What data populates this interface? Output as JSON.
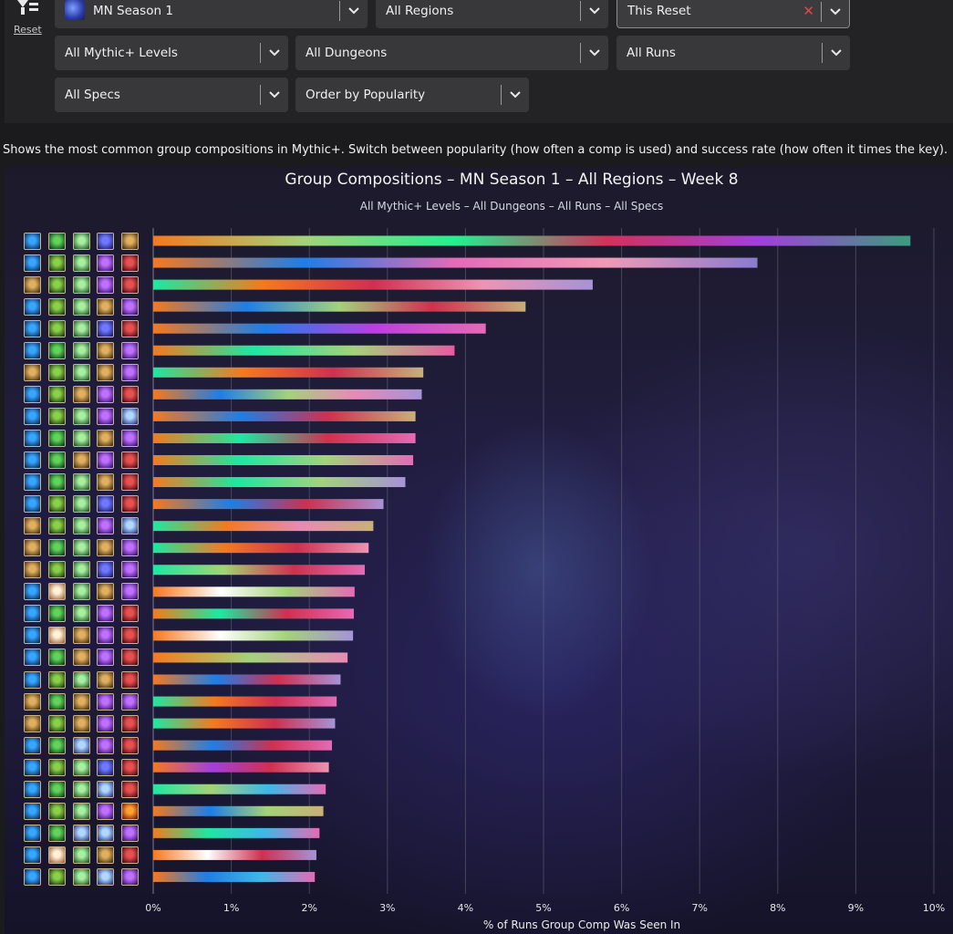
{
  "filters": {
    "reset_label": "Reset",
    "season": "MN Season 1",
    "region": "All Regions",
    "period": "This Reset",
    "level": "All Mythic+ Levels",
    "dungeon": "All Dungeons",
    "runs": "All Runs",
    "specs": "All Specs",
    "order": "Order by Popularity"
  },
  "description": "Shows the most common group compositions in Mythic+. Switch between popularity (how often a comp is used) and success rate (how often it times the key).",
  "colors": {
    "select_bg": "#38383a",
    "clear": "#e04848",
    "icon_border": "#c9b48a",
    "grid": "#6a6a7a"
  },
  "chart_data": {
    "type": "bar",
    "orientation": "horizontal",
    "title": "Group Compositions – MN Season 1 – All Regions – Week 8",
    "subtitle": "All Mythic+ Levels – All Dungeons – All Runs – All Specs",
    "xlabel": "% of Runs Group Comp Was Seen In",
    "xlim": [
      0,
      10
    ],
    "xticks": [
      "0%",
      "1%",
      "2%",
      "3%",
      "4%",
      "5%",
      "6%",
      "7%",
      "8%",
      "9%",
      "10%"
    ],
    "grid": true,
    "values": [
      9.7,
      7.74,
      5.63,
      4.77,
      4.26,
      3.86,
      3.46,
      3.44,
      3.36,
      3.36,
      3.33,
      3.23,
      2.95,
      2.82,
      2.76,
      2.71,
      2.58,
      2.57,
      2.56,
      2.49,
      2.4,
      2.35,
      2.33,
      2.29,
      2.25,
      2.21,
      2.18,
      2.13,
      2.09,
      2.07
    ],
    "bar_colors": [
      [
        "#f5791e",
        "#a4d27a",
        "#23f08f",
        "#d3315a",
        "#a23fdc",
        "#3d9c7e"
      ],
      [
        "#f5791e",
        "#1e7ee6",
        "#e56bb8",
        "#f09ab6",
        "#8a7bd0"
      ],
      [
        "#1de8a2",
        "#f5791e",
        "#cf3050",
        "#ef93b4",
        "#a693d6"
      ],
      [
        "#f5791e",
        "#1e7ee6",
        "#a4d27a",
        "#cf3050",
        "#c8b07a"
      ],
      [
        "#f5791e",
        "#1e7ee6",
        "#bb3fe0",
        "#e46bb5"
      ],
      [
        "#f5791e",
        "#1de8a2",
        "#a4d27a",
        "#e85ba0"
      ],
      [
        "#1de8a2",
        "#f5791e",
        "#cf3050",
        "#c8b07a"
      ],
      [
        "#f5791e",
        "#1e7ee6",
        "#a4d27a",
        "#e88ab6",
        "#a693d6"
      ],
      [
        "#f5791e",
        "#1e7ee6",
        "#cf3050",
        "#c8b07a"
      ],
      [
        "#f5791e",
        "#1de8a2",
        "#cf3050",
        "#e46bb5"
      ],
      [
        "#f5791e",
        "#1de8a2",
        "#a4d27a",
        "#e46bb5"
      ],
      [
        "#f5791e",
        "#1de8a2",
        "#a4d27a",
        "#a693d6"
      ],
      [
        "#f5791e",
        "#1e7ee6",
        "#cf3050",
        "#a693d6"
      ],
      [
        "#1de8a2",
        "#f5791e",
        "#e88ab6",
        "#c8b07a"
      ],
      [
        "#1de8a2",
        "#f5791e",
        "#cf3050",
        "#ef93b4"
      ],
      [
        "#1de8a2",
        "#a4d27a",
        "#cf3050",
        "#e46bb5"
      ],
      [
        "#f5791e",
        "#ffffff",
        "#a4d27a",
        "#e46bb5"
      ],
      [
        "#f5791e",
        "#1de8a2",
        "#cf3050",
        "#e46bb5"
      ],
      [
        "#f5791e",
        "#ffffff",
        "#a4d27a",
        "#a693d6"
      ],
      [
        "#f5791e",
        "#a4d27a",
        "#e88ab6"
      ],
      [
        "#f5791e",
        "#1e7ee6",
        "#cf3050",
        "#a693d6"
      ],
      [
        "#1de8a2",
        "#f5791e",
        "#cf3050",
        "#e46bb5"
      ],
      [
        "#1de8a2",
        "#f5791e",
        "#cf3050",
        "#a693d6"
      ],
      [
        "#f5791e",
        "#1e7ee6",
        "#cf3050",
        "#e46bb5"
      ],
      [
        "#f5791e",
        "#a23fdc",
        "#cf3050",
        "#ef93b4"
      ],
      [
        "#1de8a2",
        "#a4d27a",
        "#3db8e8",
        "#e46bb5"
      ],
      [
        "#f5791e",
        "#1e7ee6",
        "#a4d27a",
        "#c8b07a"
      ],
      [
        "#f5791e",
        "#1de8a2",
        "#3db8e8",
        "#e46bb5"
      ],
      [
        "#f5791e",
        "#ffffff",
        "#cf3050",
        "#a693d6"
      ],
      [
        "#f5791e",
        "#1e7ee6",
        "#3db8e8",
        "#e46bb5"
      ]
    ],
    "spec_icon_palette": {
      "blue-tank": [
        "#37a6ff",
        "#0d2a55"
      ],
      "green-heal": [
        "#5fd35a",
        "#0f3d1a"
      ],
      "green-dps": [
        "#8ad048",
        "#1d3a10"
      ],
      "fel-green": [
        "#a8f0a0",
        "#235a2a"
      ],
      "purple-dps": [
        "#c070ff",
        "#3a1370"
      ],
      "blue-purple": [
        "#6f78ff",
        "#1a1f6a"
      ],
      "red-dps": [
        "#e85050",
        "#4a0c18"
      ],
      "gold-dps": [
        "#e0b060",
        "#4a3210"
      ],
      "white-heal": [
        "#fff0d8",
        "#a06a40"
      ],
      "ice-dps": [
        "#b0d8ff",
        "#2a3a80"
      ],
      "fire-dps": [
        "#ffa030",
        "#7a1a08"
      ]
    },
    "spec_icons": [
      [
        "blue-tank",
        "green-heal",
        "fel-green",
        "blue-purple",
        "gold-dps"
      ],
      [
        "blue-tank",
        "green-dps",
        "fel-green",
        "purple-dps",
        "red-dps"
      ],
      [
        "gold-dps",
        "green-dps",
        "fel-green",
        "purple-dps",
        "red-dps"
      ],
      [
        "blue-tank",
        "green-dps",
        "fel-green",
        "gold-dps",
        "purple-dps"
      ],
      [
        "blue-tank",
        "green-dps",
        "fel-green",
        "blue-purple",
        "red-dps"
      ],
      [
        "blue-tank",
        "green-heal",
        "fel-green",
        "gold-dps",
        "purple-dps"
      ],
      [
        "gold-dps",
        "green-dps",
        "fel-green",
        "gold-dps",
        "purple-dps"
      ],
      [
        "blue-tank",
        "green-dps",
        "gold-dps",
        "purple-dps",
        "red-dps"
      ],
      [
        "blue-tank",
        "green-dps",
        "fel-green",
        "purple-dps",
        "ice-dps"
      ],
      [
        "blue-tank",
        "green-heal",
        "fel-green",
        "gold-dps",
        "purple-dps"
      ],
      [
        "blue-tank",
        "green-heal",
        "gold-dps",
        "purple-dps",
        "red-dps"
      ],
      [
        "blue-tank",
        "green-heal",
        "fel-green",
        "gold-dps",
        "red-dps"
      ],
      [
        "blue-tank",
        "green-dps",
        "fel-green",
        "blue-purple",
        "red-dps"
      ],
      [
        "gold-dps",
        "green-dps",
        "fel-green",
        "purple-dps",
        "ice-dps"
      ],
      [
        "gold-dps",
        "green-heal",
        "fel-green",
        "gold-dps",
        "purple-dps"
      ],
      [
        "gold-dps",
        "green-dps",
        "fel-green",
        "blue-purple",
        "purple-dps"
      ],
      [
        "blue-tank",
        "white-heal",
        "fel-green",
        "gold-dps",
        "purple-dps"
      ],
      [
        "blue-tank",
        "green-heal",
        "fel-green",
        "purple-dps",
        "red-dps"
      ],
      [
        "blue-tank",
        "white-heal",
        "gold-dps",
        "purple-dps",
        "red-dps"
      ],
      [
        "blue-tank",
        "green-heal",
        "gold-dps",
        "purple-dps",
        "red-dps"
      ],
      [
        "blue-tank",
        "green-dps",
        "fel-green",
        "gold-dps",
        "red-dps"
      ],
      [
        "gold-dps",
        "green-heal",
        "gold-dps",
        "purple-dps",
        "purple-dps"
      ],
      [
        "gold-dps",
        "green-dps",
        "gold-dps",
        "purple-dps",
        "red-dps"
      ],
      [
        "blue-tank",
        "green-heal",
        "ice-dps",
        "purple-dps",
        "red-dps"
      ],
      [
        "blue-tank",
        "green-dps",
        "fel-green",
        "blue-purple",
        "red-dps"
      ],
      [
        "blue-tank",
        "green-heal",
        "fel-green",
        "ice-dps",
        "red-dps"
      ],
      [
        "blue-tank",
        "green-dps",
        "fel-green",
        "purple-dps",
        "fire-dps"
      ],
      [
        "blue-tank",
        "green-heal",
        "ice-dps",
        "ice-dps",
        "purple-dps"
      ],
      [
        "blue-tank",
        "white-heal",
        "fel-green",
        "gold-dps",
        "red-dps"
      ],
      [
        "blue-tank",
        "green-dps",
        "fel-green",
        "ice-dps",
        "purple-dps"
      ]
    ]
  }
}
